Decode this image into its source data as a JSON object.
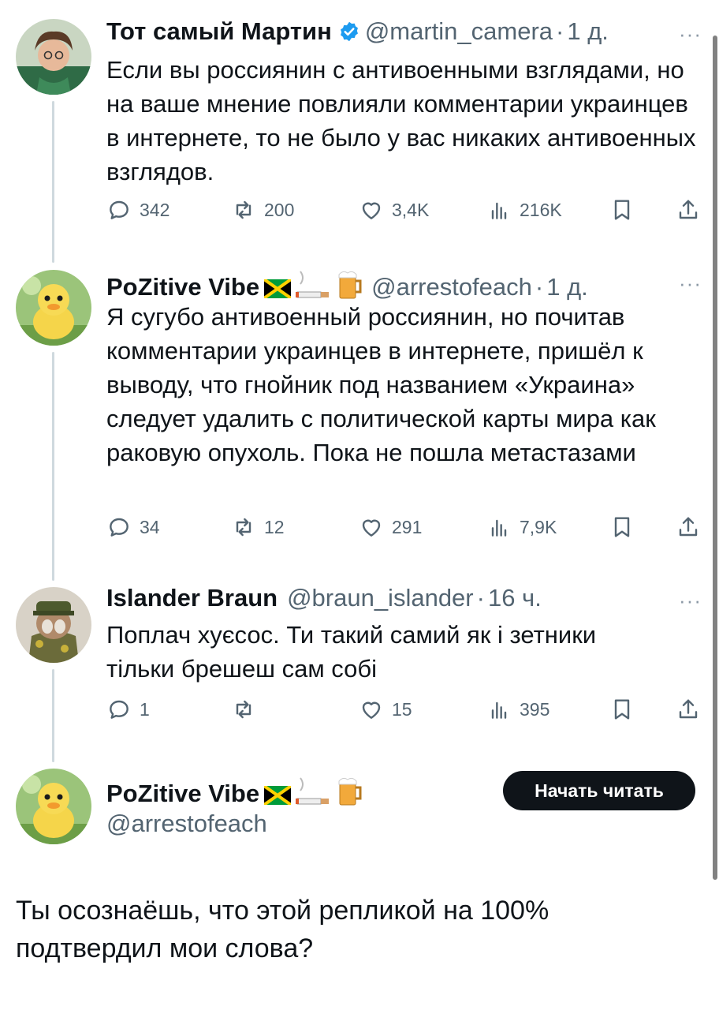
{
  "tweets": [
    {
      "name": "Тот самый Мартин",
      "verified": true,
      "handle": "@martin_camera",
      "dot": "·",
      "time": "1 д.",
      "more": "···",
      "text": "Если вы россиянин с антивоенными взглядами, но на ваше мнение повлияли комментарии украинцев в интернете, то не было у вас никаких антивоенных взглядов.",
      "replies": "342",
      "reposts": "200",
      "likes": "3,4K",
      "views": "216K"
    },
    {
      "name": "PoZitive Vibe",
      "handle": "@arrestofeach",
      "dot": "·",
      "time": "1 д.",
      "more": "···",
      "text": "Я сугубо антивоенный россиянин, но почитав комментарии украинцев в интернете, пришёл к выводу, что гнойник под названием «Украина» следует удалить с политической карты мира как раковую опухоль. Пока не пошла метастазами",
      "replies": "34",
      "reposts": "12",
      "likes": "291",
      "views": "7,9K"
    },
    {
      "name": "Islander Braun",
      "handle": "@braun_islander",
      "dot": "·",
      "time": "16 ч.",
      "more": "···",
      "text": "Поплач хуєсос. Ти такий самий як і зетники тільки брешеш сам собі",
      "replies": "1",
      "reposts": "",
      "likes": "15",
      "views": "395"
    }
  ],
  "reply": {
    "name": "PoZitive Vibe",
    "handle": "@arrestofeach",
    "follow_label": "Начать читать",
    "text": "Ты осознаёшь, что этой репликой на 100% подтвердил мои слова?"
  },
  "colors": {
    "text": "#0f1419",
    "secondary": "#536471",
    "verified": "#1d9bf0",
    "thread_line": "#cfd9de"
  }
}
